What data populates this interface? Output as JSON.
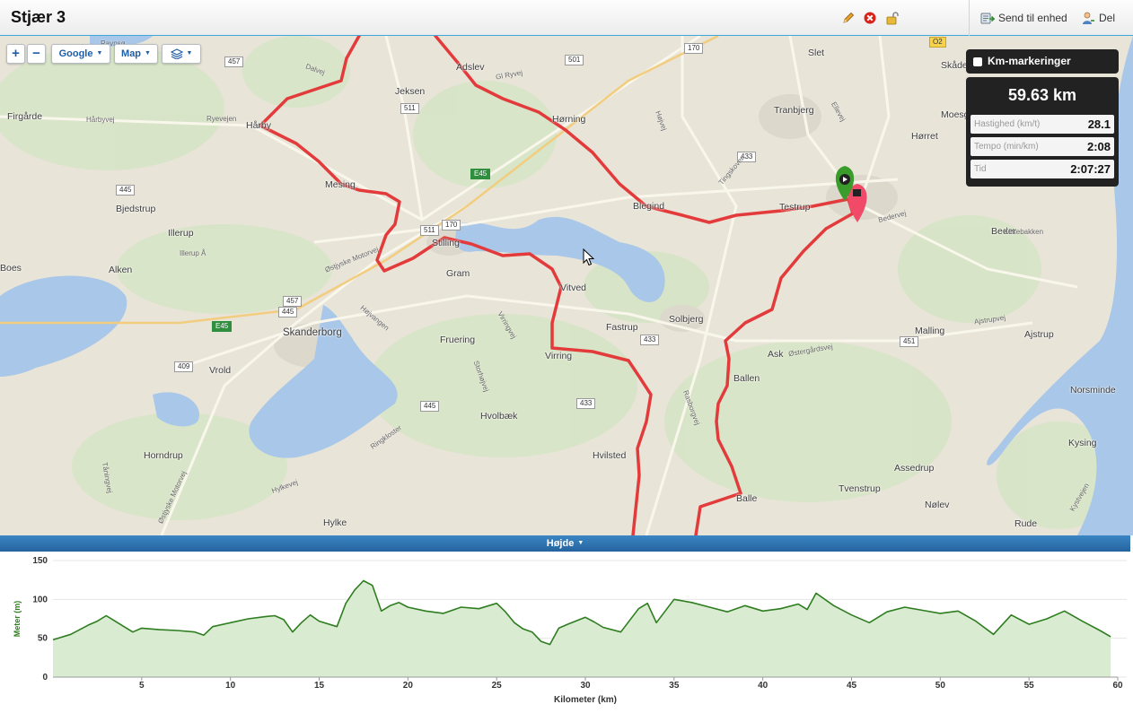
{
  "header": {
    "title": "Stjær 3",
    "send_label": "Send til enhed",
    "share_label": "Del"
  },
  "map_controls": {
    "zoom_in": "+",
    "zoom_out": "−",
    "provider": "Google",
    "map_type": "Map"
  },
  "stats": {
    "km_markers_label": "Km-markeringer",
    "distance": "59.63 km",
    "speed_label": "Hastighed (km/t)",
    "speed_value": "28.1",
    "tempo_label": "Tempo (min/km)",
    "tempo_value": "2:08",
    "time_label": "Tid",
    "time_value": "2:07:27"
  },
  "places": [
    {
      "name": "Firgårde"
    },
    {
      "name": "Hårby"
    },
    {
      "name": "Jeksen"
    },
    {
      "name": "Adslev"
    },
    {
      "name": "Hørning"
    },
    {
      "name": "Slet"
    },
    {
      "name": "Tranbjerg"
    },
    {
      "name": "Hørret"
    },
    {
      "name": "Moesgaard"
    },
    {
      "name": "Skåde"
    },
    {
      "name": "Mesing"
    },
    {
      "name": "Bjedstrup"
    },
    {
      "name": "Illerup"
    },
    {
      "name": "Blegind"
    },
    {
      "name": "Testrup"
    },
    {
      "name": "Beder"
    },
    {
      "name": "Alken"
    },
    {
      "name": "Stilling"
    },
    {
      "name": "Gram"
    },
    {
      "name": "Vitved"
    },
    {
      "name": "Solbjerg"
    },
    {
      "name": "Fastrup"
    },
    {
      "name": "Skanderborg"
    },
    {
      "name": "Fruering"
    },
    {
      "name": "Virring"
    },
    {
      "name": "Ask"
    },
    {
      "name": "Malling"
    },
    {
      "name": "Ajstrup"
    },
    {
      "name": "Vrold"
    },
    {
      "name": "Ballen"
    },
    {
      "name": "Norsminde"
    },
    {
      "name": "Hvolbæk"
    },
    {
      "name": "Horndrup"
    },
    {
      "name": "Hvilsted"
    },
    {
      "name": "Kysing"
    },
    {
      "name": "Assedrup"
    },
    {
      "name": "Tvenstrup"
    },
    {
      "name": "Balle"
    },
    {
      "name": "Nølev"
    },
    {
      "name": "Hylke"
    },
    {
      "name": "Rude"
    },
    {
      "name": "Boes"
    }
  ],
  "road_shields": [
    "457",
    "511",
    "501",
    "170",
    "E45",
    "445",
    "511",
    "170",
    "433",
    "457",
    "445",
    "E45",
    "409",
    "433",
    "445",
    "433",
    "451",
    "O2"
  ],
  "road_labels": [
    "Dalvej",
    "Ryevejen",
    "Hårbyvej",
    "Gl Ryvej",
    "Højvej",
    "Ravnsø",
    "Østjyske Motorvej",
    "Illerup Å",
    "Højvangen",
    "Virringvej",
    "Storhøjvej",
    "Tingskoven",
    "Bedervej",
    "Kirkebakken",
    "Ajstrupvej",
    "Østergårdsvej",
    "Ringkloster",
    "Tåningvej",
    "Hylkevej",
    "Østjyske Motorvej",
    "Rasborgvej",
    "Ellevej",
    "Kystvejen"
  ],
  "elevation": {
    "bar_label": "Højde",
    "y_axis_label": "Meter (m)",
    "x_axis_label": "Kilometer (km)"
  },
  "chart_data": {
    "type": "area",
    "title": "",
    "xlabel": "Kilometer (km)",
    "ylabel": "Meter (m)",
    "xlim": [
      0,
      60
    ],
    "ylim": [
      0,
      150
    ],
    "x_ticks": [
      5,
      10,
      15,
      20,
      25,
      30,
      35,
      40,
      45,
      50,
      55,
      60
    ],
    "y_ticks": [
      0,
      50,
      100,
      150
    ],
    "grid": true,
    "color": "#2e7d1f",
    "fill": "#d9ecd2",
    "x": [
      0,
      1,
      2,
      2.5,
      3,
      3.5,
      4,
      4.5,
      5,
      6,
      7,
      8,
      8.5,
      9,
      10,
      11,
      12,
      12.5,
      13,
      13.5,
      14,
      14.5,
      15,
      16,
      16.5,
      17,
      17.5,
      18,
      18.5,
      19,
      19.5,
      20,
      21,
      22,
      23,
      24,
      25,
      25.5,
      26,
      26.5,
      27,
      27.5,
      28,
      28.5,
      29,
      30,
      30.5,
      31,
      32,
      33,
      33.5,
      34,
      35,
      36,
      37,
      38,
      39,
      40,
      41,
      42,
      42.5,
      43,
      44,
      45,
      46,
      47,
      48,
      49,
      50,
      51,
      52,
      53,
      54,
      55,
      56,
      57,
      58,
      59,
      59.6
    ],
    "values": [
      48,
      55,
      67,
      72,
      79,
      72,
      65,
      58,
      63,
      61,
      60,
      58,
      54,
      65,
      70,
      75,
      78,
      79,
      74,
      58,
      70,
      80,
      72,
      65,
      95,
      112,
      124,
      118,
      85,
      92,
      96,
      90,
      85,
      82,
      90,
      88,
      95,
      84,
      70,
      62,
      58,
      46,
      42,
      63,
      68,
      77,
      71,
      64,
      58,
      88,
      95,
      70,
      100,
      96,
      90,
      84,
      92,
      85,
      88,
      94,
      87,
      108,
      92,
      80,
      70,
      84,
      90,
      86,
      82,
      85,
      72,
      55,
      80,
      68,
      75,
      85,
      72,
      60,
      52
    ]
  }
}
